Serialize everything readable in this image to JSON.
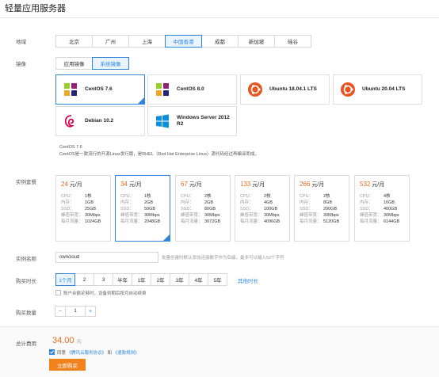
{
  "page": {
    "title": "轻量应用服务器"
  },
  "region": {
    "label": "地域",
    "options": [
      "北京",
      "广州",
      "上海",
      "中国香港",
      "成都",
      "新加坡",
      "硅谷"
    ],
    "selected": "中国香港"
  },
  "image": {
    "label": "镜像",
    "tabs": [
      "应用镜像",
      "系统镜像"
    ],
    "selected_tab": "系统镜像",
    "os_list": [
      {
        "name": "CentOS 7.6",
        "icon": "centos-icon"
      },
      {
        "name": "CentOS 8.0",
        "icon": "centos-icon"
      },
      {
        "name": "Ubuntu 18.04.1 LTS",
        "icon": "ubuntu-icon"
      },
      {
        "name": "Ubuntu 20.04 LTS",
        "icon": "ubuntu-icon"
      },
      {
        "name": "Debian 10.2",
        "icon": "debian-icon"
      },
      {
        "name": "Windows Server 2012 R2",
        "icon": "windows-icon"
      }
    ],
    "selected_os": "CentOS 7.6",
    "desc_title": "CentOS 7.6",
    "desc_text": "CentOS是一款流行的开源Linux发行版，是RHEL（Red Hat Enterprise Linux）源代码经过再编译而成。"
  },
  "plans": {
    "label": "实例套餐",
    "unit": "元/月",
    "keys": {
      "cpu": "CPU：",
      "mem": "内存：",
      "ssd": "SSD：",
      "bw": "峰值带宽：",
      "traffic": "每月流量："
    },
    "items": [
      {
        "price": "24",
        "cpu": "1核",
        "mem": "1GB",
        "ssd": "25GB",
        "bw": "30Mbps",
        "traffic": "1024GB"
      },
      {
        "price": "34",
        "cpu": "1核",
        "mem": "2GB",
        "ssd": "50GB",
        "bw": "30Mbps",
        "traffic": "2048GB"
      },
      {
        "price": "67",
        "cpu": "2核",
        "mem": "2GB",
        "ssd": "80GB",
        "bw": "30Mbps",
        "traffic": "3072GB"
      },
      {
        "price": "133",
        "cpu": "2核",
        "mem": "4GB",
        "ssd": "100GB",
        "bw": "30Mbps",
        "traffic": "4096GB"
      },
      {
        "price": "266",
        "cpu": "2核",
        "mem": "8GB",
        "ssd": "200GB",
        "bw": "30Mbps",
        "traffic": "5120GB"
      },
      {
        "price": "532",
        "cpu": "4核",
        "mem": "16GB",
        "ssd": "400GB",
        "bw": "30Mbps",
        "traffic": "6144GB"
      }
    ],
    "selected_index": 1
  },
  "instance_name": {
    "label": "实例名称",
    "value": "owncloud",
    "hint": "批量创建时默认添加连接数字作为后缀，最多可以输入52个字符"
  },
  "duration": {
    "label": "购买时长",
    "options": [
      "1个月",
      "2",
      "3",
      "半年",
      "1年",
      "2年",
      "3年",
      "4年",
      "5年"
    ],
    "selected": "1个月",
    "other_link": "其他时长",
    "auto_renew": "账户余额足够时，设备到期后按月自动续费"
  },
  "quantity": {
    "label": "购买数量",
    "minus": "−",
    "value": "1",
    "plus": "+"
  },
  "footer": {
    "total_label": "总计费用",
    "total_value": "34.00",
    "total_unit": "元",
    "agree_prefix": "同意",
    "agree_link1": "《腾讯云服务协议》",
    "agree_and": "和",
    "agree_link2": "《退款规则》",
    "buy_button": "立即购买"
  },
  "colors": {
    "accent": "#2e86de",
    "price": "#e86b1f",
    "buy": "#f0831e"
  }
}
